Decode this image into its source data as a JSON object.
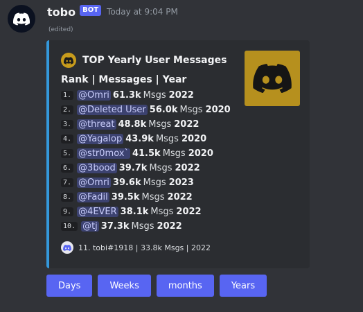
{
  "message": {
    "author": "tobo",
    "bot_badge": "BOT",
    "timestamp": "Today at 9:04 PM",
    "edited": "(edited)"
  },
  "embed": {
    "author_name": "TOP Yearly User Messages",
    "subtitle": "Rank | Messages | Year",
    "accent_color": "#3498db",
    "rows": [
      {
        "rank": "1.",
        "user": "@Omri",
        "count": "61.3k",
        "unit": "Msgs",
        "year": "2022"
      },
      {
        "rank": "2.",
        "user": "@Deleted User",
        "count": "56.0k",
        "unit": "Msgs",
        "year": "2020"
      },
      {
        "rank": "3.",
        "user": "@threat",
        "count": "48.8k",
        "unit": "Msgs",
        "year": "2022"
      },
      {
        "rank": "4.",
        "user": "@Yagalop",
        "count": "43.9k",
        "unit": "Msgs",
        "year": "2020"
      },
      {
        "rank": "5.",
        "user": "@str0mox`",
        "count": "41.5k",
        "unit": "Msgs",
        "year": "2020"
      },
      {
        "rank": "6.",
        "user": "@3bood",
        "count": "39.7k",
        "unit": "Msgs",
        "year": "2022"
      },
      {
        "rank": "7.",
        "user": "@Omri",
        "count": "39.6k",
        "unit": "Msgs",
        "year": "2023"
      },
      {
        "rank": "8.",
        "user": "@Fadil",
        "count": "39.5k",
        "unit": "Msgs",
        "year": "2022"
      },
      {
        "rank": "9.",
        "user": "@4EVER",
        "count": "38.1k",
        "unit": "Msgs",
        "year": "2022"
      },
      {
        "rank": "10.",
        "user": "@tj",
        "count": "37.3k",
        "unit": "Msgs",
        "year": "2022"
      }
    ],
    "footer": "11. tobi#1918 | 33.8k Msgs | 2022",
    "icons": {
      "author": "discord-logo-icon",
      "thumbnail": "discord-logo-icon",
      "footer": "discord-logo-icon"
    }
  },
  "buttons": [
    {
      "label": "Days"
    },
    {
      "label": "Weeks"
    },
    {
      "label": "months"
    },
    {
      "label": "Years"
    }
  ],
  "colors": {
    "background": "#313338",
    "embed_background": "#2b2d31",
    "button": "#5865f2",
    "thumbnail": "#b6901e",
    "mention_background": "#3c4270"
  }
}
